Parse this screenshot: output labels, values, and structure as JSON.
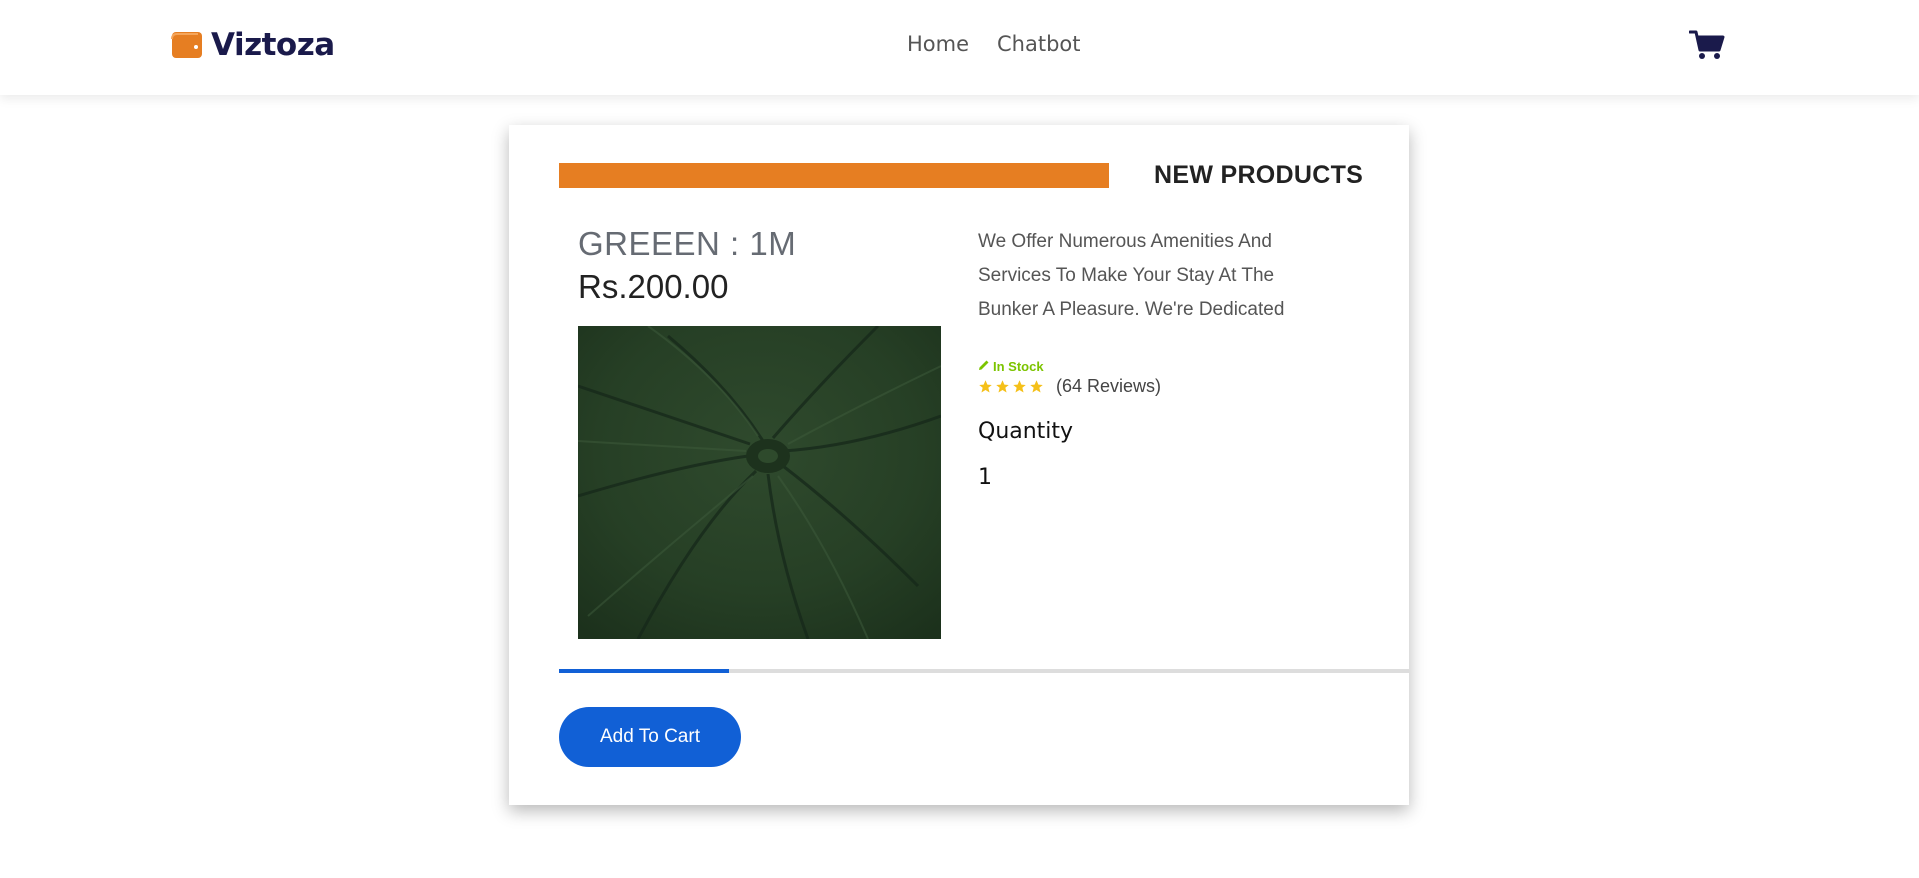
{
  "brand": {
    "name": "Viztoza",
    "accent": "#e67e22",
    "icon": "wallet-icon"
  },
  "nav": {
    "links": [
      {
        "label": "Home"
      },
      {
        "label": "Chatbot"
      }
    ],
    "cart_icon": "shopping-cart-icon"
  },
  "section": {
    "title": "NEW PRODUCTS"
  },
  "product": {
    "name": "GREEEN : 1M",
    "price": "Rs.200.00",
    "image_alt": "green fabric swirl",
    "description": "We Offer Numerous Amenities And Services To Make Your Stay At The Bunker A Pleasure. We're Dedicated",
    "stock_label": "In Stock",
    "stock_color": "#7cc400",
    "rating_stars": 4,
    "reviews_label": "(64 Reviews)",
    "quantity_label": "Quantity",
    "quantity_value": "1"
  },
  "progress": {
    "value": 0.2,
    "color": "#1160d6"
  },
  "actions": {
    "add_to_cart_label": "Add To Cart",
    "button_color": "#1160d6"
  }
}
